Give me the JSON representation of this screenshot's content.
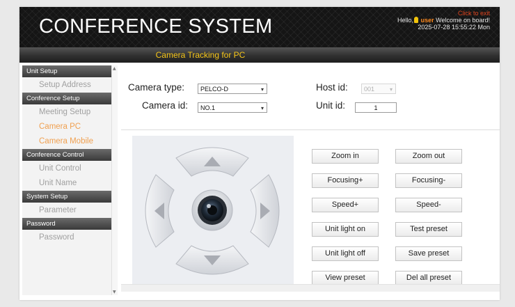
{
  "header": {
    "title": "CONFERENCE SYSTEM",
    "exit_link": "Click to exit",
    "greeting_prefix": "Hello,",
    "username": "user",
    "greeting_suffix": "Welcome on board!",
    "datetime": "2025-07-28 15:55:22 Mon",
    "subtitle": "Camera Tracking for PC"
  },
  "sidebar": {
    "sections": [
      {
        "title": "Unit Setup",
        "items": [
          {
            "label": "Setup Address",
            "active": false
          }
        ]
      },
      {
        "title": "Conference Setup",
        "items": [
          {
            "label": "Meeting Setup",
            "active": false
          },
          {
            "label": "Camera PC",
            "active": true
          },
          {
            "label": "Camera Mobile",
            "active": true
          }
        ]
      },
      {
        "title": "Conference Control",
        "items": [
          {
            "label": "Unit Control",
            "active": false
          },
          {
            "label": "Unit Name",
            "active": false
          }
        ]
      },
      {
        "title": "System Setup",
        "items": [
          {
            "label": "Parameter",
            "active": false
          }
        ]
      },
      {
        "title": "Password",
        "items": [
          {
            "label": "Password",
            "active": false
          }
        ]
      }
    ]
  },
  "form": {
    "camera_type_label": "Camera type:",
    "camera_type_value": "PELCO-D",
    "camera_id_label": "Camera id:",
    "camera_id_value": "NO.1",
    "host_id_label": "Host id:",
    "host_id_value": "001",
    "unit_id_label": "Unit id:",
    "unit_id_value": "1"
  },
  "controls": {
    "zoom_in": "Zoom in",
    "zoom_out": "Zoom out",
    "focusing_plus": "Focusing+",
    "focusing_minus": "Focusing-",
    "speed_plus": "Speed+",
    "speed_minus": "Speed-",
    "unit_light_on": "Unit light on",
    "test_preset": "Test preset",
    "unit_light_off": "Unit light off",
    "save_preset": "Save preset",
    "view_preset": "View preset",
    "del_all_preset": "Del all preset"
  },
  "icons": {
    "up": "triangle-up-icon",
    "down": "triangle-down-icon",
    "left": "triangle-left-icon",
    "right": "triangle-right-icon",
    "center": "camera-lens-icon",
    "user": "user-icon"
  },
  "colors": {
    "accent_orange": "#f0a050",
    "exit_red": "#e0441e",
    "subtitle_yellow": "#f5c518",
    "header_bg": "#151515"
  }
}
